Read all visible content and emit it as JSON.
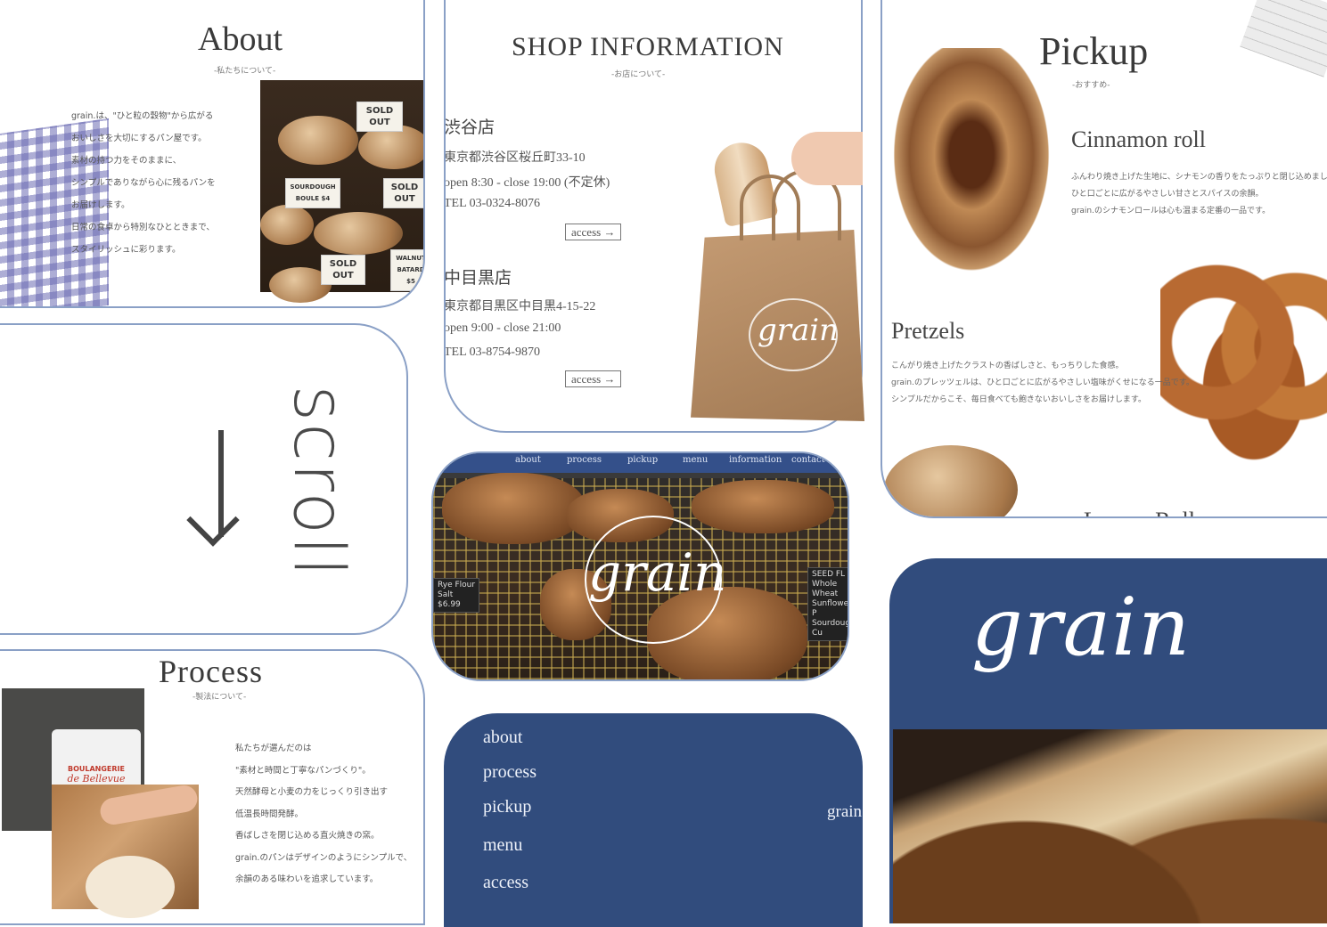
{
  "about": {
    "title": "About",
    "subtitle": "-私たちについて-",
    "lines": [
      "grain.は、\"ひと粒の穀物\"から広がる",
      "おいしさを大切にするパン屋です。",
      "素材の持つ力をそのままに、",
      "シンプルでありながら心に残るパンを",
      "お届けします。",
      "日常の食卓から特別なひとときまで、",
      "スタイリッシュに彩ります。"
    ],
    "signs": [
      "SOLD OUT",
      "SOURDOUGH BOULE $4",
      "SOLD OUT",
      "SOLD OUT",
      "WALNUT BATARD $5"
    ]
  },
  "shop": {
    "title": "SHOP INFORMATION",
    "subtitle": "-お店について-",
    "stores": [
      {
        "name": "渋谷店",
        "address": "東京都渋谷区桜丘町33-10",
        "hours": "open 8:30 - close 19:00 (不定休)",
        "tel": "TEL 03-0324-8076",
        "access": "access →"
      },
      {
        "name": "中目黒店",
        "address": "東京都目黒区中目黒4-15-22",
        "hours": "open 9:00 - close 21:00",
        "tel": "TEL 03-8754-9870",
        "access": "access →"
      }
    ],
    "bag_logo": "grain"
  },
  "pickup": {
    "title": "Pickup",
    "subtitle": "-おすすめ-",
    "items": [
      {
        "name": "Cinnamon roll",
        "lines": [
          "ふんわり焼き上げた生地に、シナモンの香りをたっぷりと閉じ込めました。",
          "ひと口ごとに広がるやさしい甘さとスパイスの余韻。",
          "grain.のシナモンロールは心も温まる定番の一品です。"
        ]
      },
      {
        "name": "Pretzels",
        "lines": [
          "こんがり焼き上げたクラストの香ばしさと、もっちりした食感。",
          "grain.のプレッツェルは、ひと口ごとに広がるやさしい塩味がくせになる一品です。",
          "シンプルだからこそ、毎日食べても飽きないおいしさをお届けします。"
        ]
      }
    ],
    "partial_item": "Lemon Roll"
  },
  "scroll": {
    "label": "scroll",
    "arrow": "↓"
  },
  "hero": {
    "nav": [
      "about",
      "process",
      "pickup",
      "menu",
      "information",
      "contact"
    ],
    "logo": "grain",
    "board1": [
      "Rye Flour",
      "Salt",
      "$6.99"
    ],
    "board2": [
      "SEED FL",
      "Whole Wheat",
      "Sunflower, P",
      "Sourdough Cu"
    ]
  },
  "process": {
    "title": "Process",
    "subtitle": "-製法について-",
    "bag_text": [
      "BOULANGERIE",
      "de Bellevue"
    ],
    "lines": [
      "私たちが選んだのは",
      "\"素材と時間と丁寧なパンづくり\"。",
      "天然酵母と小麦の力をじっくり引き出す",
      "低温長時間発酵。",
      "香ばしさを閉じ込める直火焼きの窯。",
      "grain.のパンはデザインのようにシンプルで、",
      "余韻のある味わいを追求しています。"
    ]
  },
  "menu": {
    "items": [
      "about",
      "process",
      "pickup",
      "menu",
      "access"
    ],
    "brand": "grain"
  },
  "big": {
    "logo": "grain"
  }
}
